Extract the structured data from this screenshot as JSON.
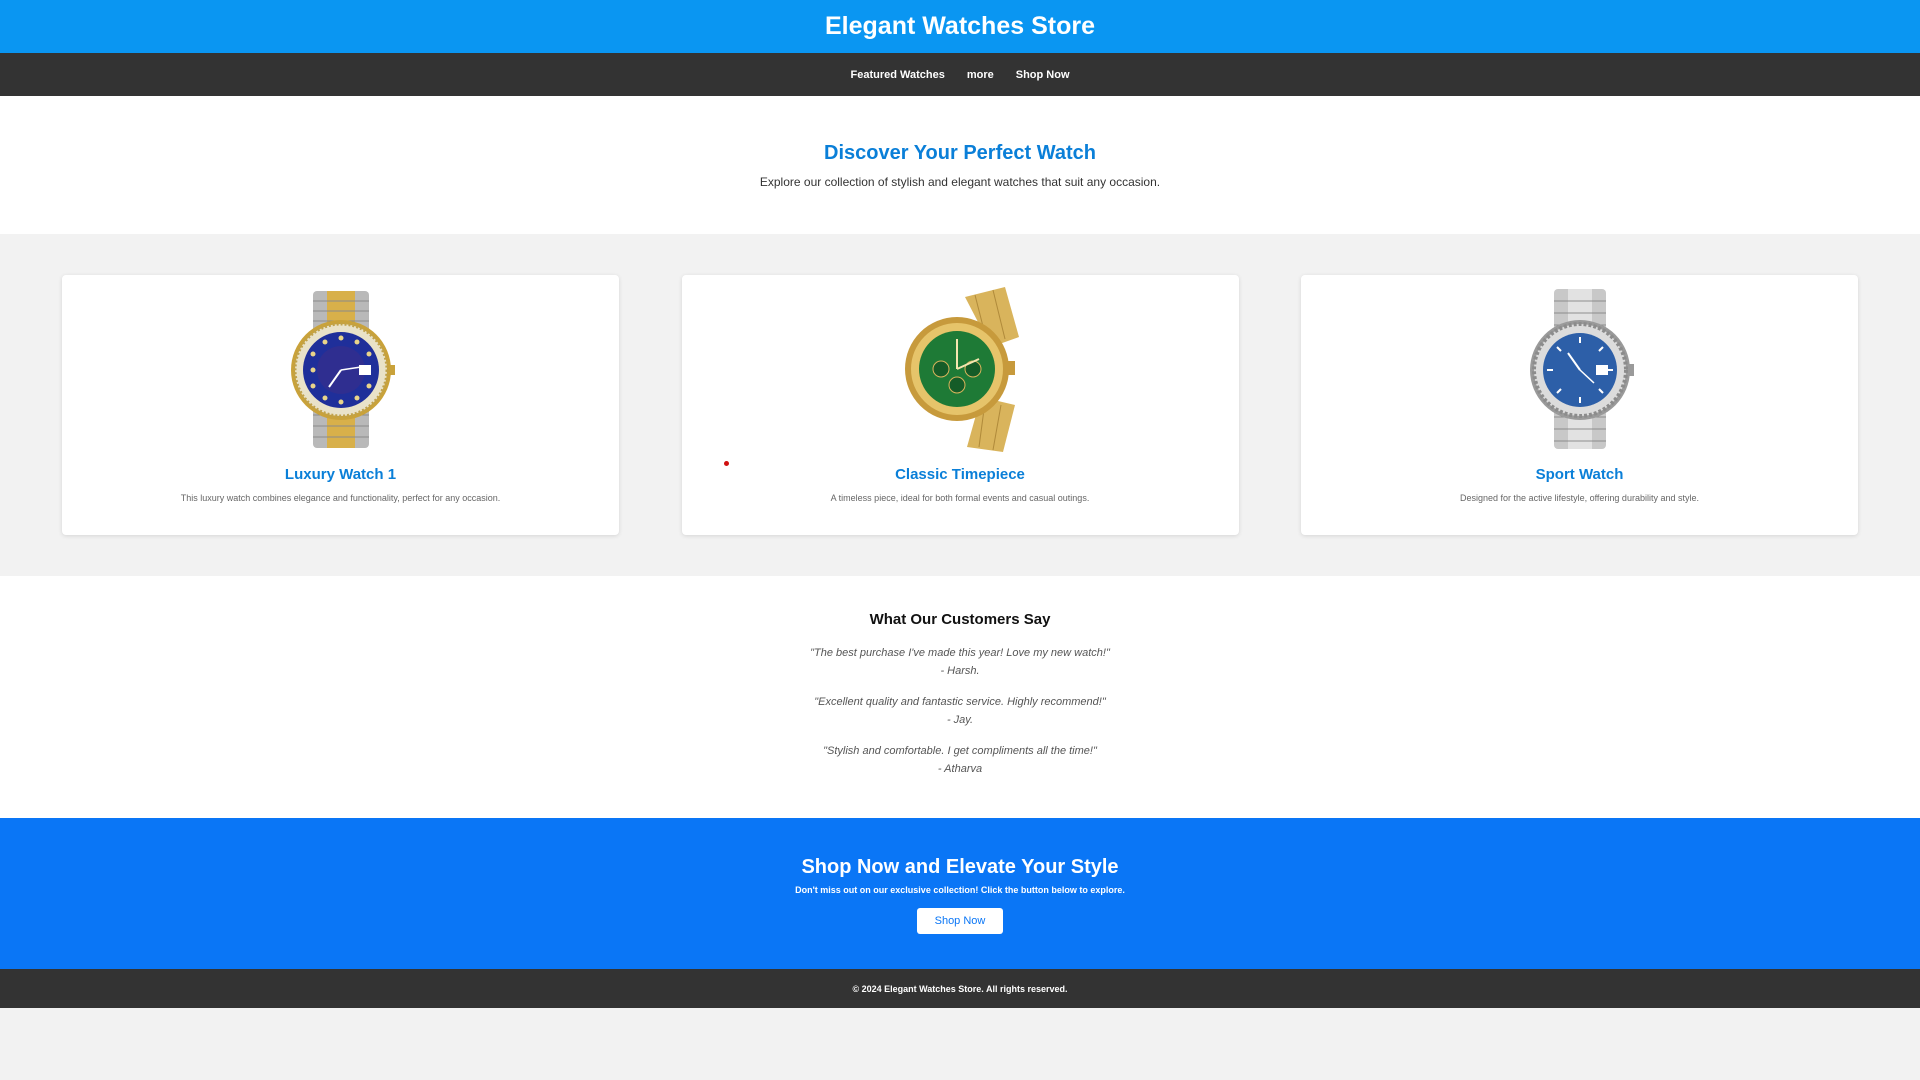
{
  "header": {
    "title": "Elegant Watches Store"
  },
  "nav": {
    "items": [
      "Featured Watches",
      "more",
      "Shop Now"
    ]
  },
  "hero": {
    "title": "Discover Your Perfect Watch",
    "subtitle": "Explore our collection of stylish and elegant watches that suit any occasion."
  },
  "products": [
    {
      "title": "Luxury Watch 1",
      "description": "This luxury watch combines elegance and functionality, perfect for any occasion.",
      "icon": "watch-gold-blue-dial",
      "dial_color": "#1f2f9a"
    },
    {
      "title": "Classic Timepiece",
      "description": "A timeless piece, ideal for both formal events and casual outings.",
      "icon": "watch-gold-green-dial",
      "dial_color": "#1e7a36"
    },
    {
      "title": "Sport Watch",
      "description": "Designed for the active lifestyle, offering durability and style.",
      "icon": "watch-steel-blue-dial",
      "dial_color": "#2d5fa8"
    }
  ],
  "testimonials": {
    "title": "What Our Customers Say",
    "items": [
      {
        "quote": "\"The best purchase I've made this year! Love my new watch!\"",
        "author": "- Harsh."
      },
      {
        "quote": "\"Excellent quality and fantastic service. Highly recommend!\"",
        "author": "- Jay."
      },
      {
        "quote": "\"Stylish and comfortable. I get compliments all the time!\"",
        "author": "- Atharva"
      }
    ]
  },
  "cta": {
    "title": "Shop Now and Elevate Your Style",
    "text": "Don't miss out on our exclusive collection! Click the button below to explore.",
    "button": "Shop Now"
  },
  "footer": {
    "text": "© 2024 Elegant Watches Store. All rights reserved."
  },
  "colors": {
    "header": "#0a96f2",
    "accent": "#0a7fd8",
    "cta": "#0a76f6",
    "nav": "#333333"
  }
}
